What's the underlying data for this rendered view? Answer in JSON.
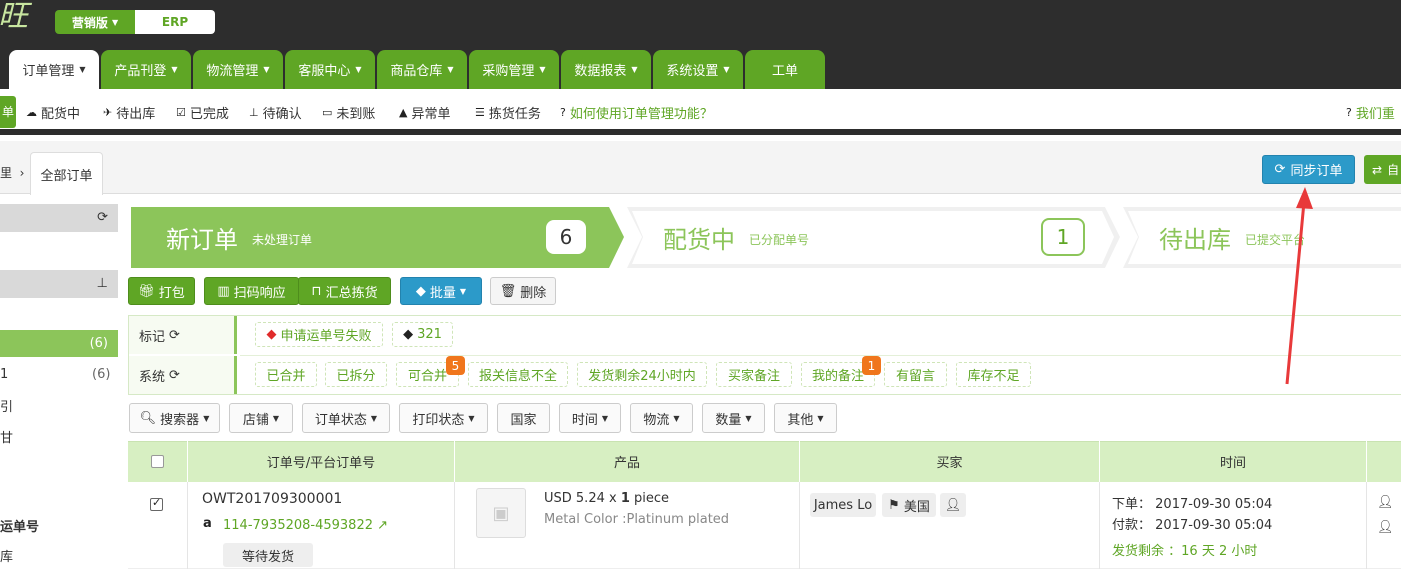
{
  "brand": {
    "logo_text": "旺",
    "edition": "营销版",
    "erp": "ERP"
  },
  "nav_tabs": [
    {
      "label": "订单管理",
      "caret": true
    },
    {
      "label": "产品刊登",
      "caret": true
    },
    {
      "label": "物流管理",
      "caret": true
    },
    {
      "label": "客服中心",
      "caret": true
    },
    {
      "label": "商品仓库",
      "caret": true
    },
    {
      "label": "采购管理",
      "caret": true
    },
    {
      "label": "数据报表",
      "caret": true
    },
    {
      "label": "系统设置",
      "caret": true
    },
    {
      "label": "工单",
      "caret": false
    }
  ],
  "subnav": {
    "first": "单",
    "items": [
      "配货中",
      "待出库",
      "已完成",
      "待确认",
      "未到账",
      "异常单",
      "拣货任务"
    ],
    "help": "如何使用订单管理功能？",
    "right_help": "我们重"
  },
  "breadcrumb": {
    "prefix": "里",
    "tab": "全部订单"
  },
  "top_buttons": {
    "sync": "同步订单",
    "other": "自"
  },
  "sidebar": {
    "active_count": "(6)",
    "row2_text": "1",
    "row2_count": "(6)",
    "row3_text": "引",
    "row4_text": "甘",
    "row5_text": "运单号",
    "row6_text": "库"
  },
  "steps": [
    {
      "title": "新订单",
      "sub": "未处理订单",
      "count": "6"
    },
    {
      "title": "配货中",
      "sub": "已分配单号",
      "count": "1"
    },
    {
      "title": "待出库",
      "sub": "已提交平台"
    }
  ],
  "actions": {
    "pack": "打包",
    "scan": "扫码响应",
    "summary": "汇总拣货",
    "batch": "批量",
    "delete": "删除"
  },
  "tag_rows": {
    "mark_label": "标记",
    "mark_tags": [
      "申请运单号失败",
      "321"
    ],
    "system_label": "系统",
    "system_tags": [
      "已合并",
      "已拆分",
      "可合并",
      "报关信息不全",
      "发货剩余24小时内",
      "买家备注",
      "我的备注",
      "有留言",
      "库存不足"
    ],
    "badges": {
      "merge": "5",
      "my_note": "1"
    }
  },
  "filters": [
    "搜索器",
    "店铺",
    "订单状态",
    "打印状态",
    "国家",
    "时间",
    "物流",
    "数量",
    "其他"
  ],
  "table": {
    "headers": [
      "订单号/平台订单号",
      "产品",
      "买家",
      "时间"
    ],
    "row": {
      "order_no": "OWT201709300001",
      "platform_no": "114-7935208-4593822",
      "status": "等待发货",
      "price_prefix": "USD 5.24 x ",
      "qty": "1",
      "unit": " piece",
      "variant": "Metal Color :Platinum plated",
      "buyer": "James Lo",
      "country": "美国",
      "order_time_label": "下单：",
      "order_time": "2017-09-30 05:04",
      "pay_time_label": "付款：",
      "pay_time": "2017-09-30 05:04",
      "remaining_label": "发货剩余 ：",
      "remaining": "16 天 2 小时"
    }
  },
  "colors": {
    "green": "#5fa625",
    "light_green": "#8cc55a",
    "blue": "#2c9ac9",
    "dark": "#2d2d2d",
    "badge": "#f0761c",
    "arrow": "#e8393a"
  }
}
